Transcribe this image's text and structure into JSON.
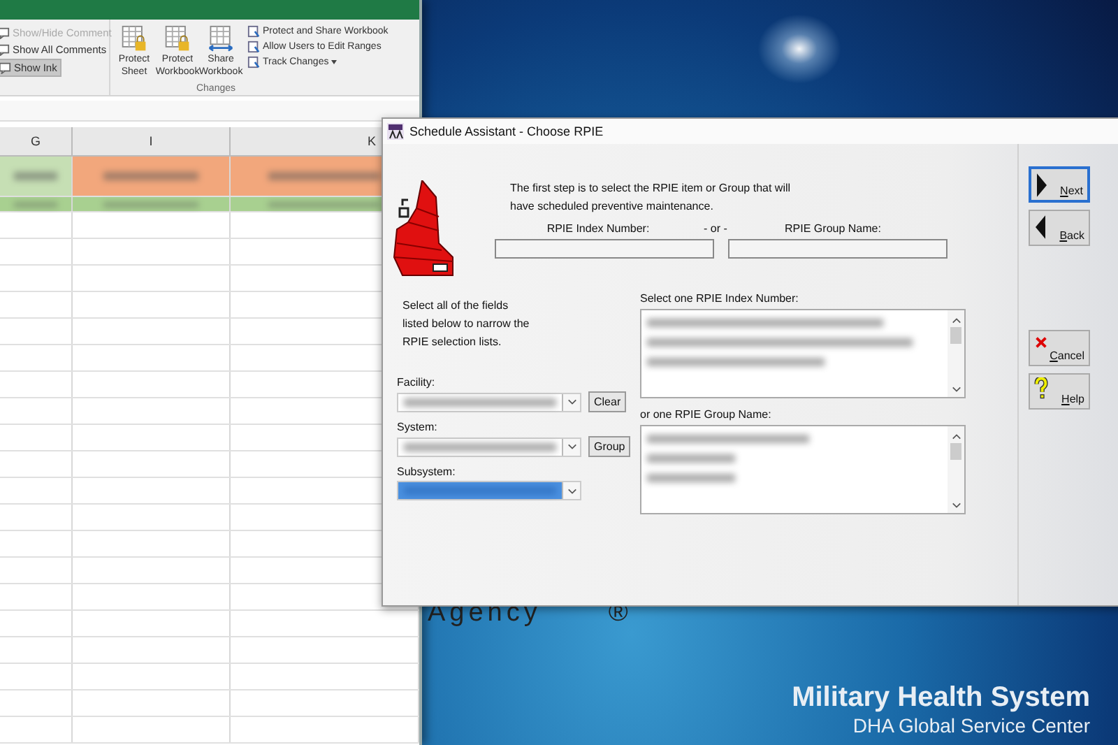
{
  "spreadsheet": {
    "ribbon": {
      "comment_items": [
        {
          "label": "Show/Hide Comment",
          "disabled": true,
          "selected": false
        },
        {
          "label": "Show All Comments",
          "disabled": false,
          "selected": false
        },
        {
          "label": "Show Ink",
          "disabled": false,
          "selected": true
        }
      ],
      "big_buttons": [
        {
          "label": "Protect Sheet",
          "kind": "lock"
        },
        {
          "label": "Protect Workbook",
          "kind": "lock"
        },
        {
          "label": "Share Workbook",
          "kind": "share"
        }
      ],
      "small_items": [
        {
          "label": "Protect and Share Workbook",
          "dropdown": false
        },
        {
          "label": "Allow Users to Edit Ranges",
          "dropdown": false
        },
        {
          "label": "Track Changes",
          "dropdown": true
        }
      ],
      "group_label": "Changes"
    },
    "columns": [
      "G",
      "I",
      "K"
    ]
  },
  "backdrop": {
    "agency": "Agency",
    "registered": "®",
    "title": "Military Health System",
    "subtitle": "DHA Global Service Center"
  },
  "dialog": {
    "title": "Schedule Assistant - Choose RPIE",
    "intro": "The first step is to select the RPIE item or Group that will have scheduled preventive maintenance.",
    "index_label": "RPIE Index Number:",
    "or_label": "- or -",
    "group_label": "RPIE Group Name:",
    "instructions": "Select all of the fields listed below to narrow the RPIE selection lists.",
    "combos": [
      {
        "label": "Facility:",
        "selected": false,
        "button": "Clear"
      },
      {
        "label": "System:",
        "selected": false,
        "button": "Group"
      },
      {
        "label": "Subsystem:",
        "selected": true
      }
    ],
    "index_list_label": "Select one RPIE Index Number:",
    "group_list_label": "or one RPIE Group Name:",
    "buttons": [
      {
        "label": "Next",
        "kind": "next",
        "focused": true
      },
      {
        "label": "Back",
        "kind": "back",
        "focused": false
      },
      {
        "label": "Cancel",
        "kind": "cancel",
        "focused": false
      },
      {
        "label": "Help",
        "kind": "help",
        "focused": false
      }
    ]
  }
}
